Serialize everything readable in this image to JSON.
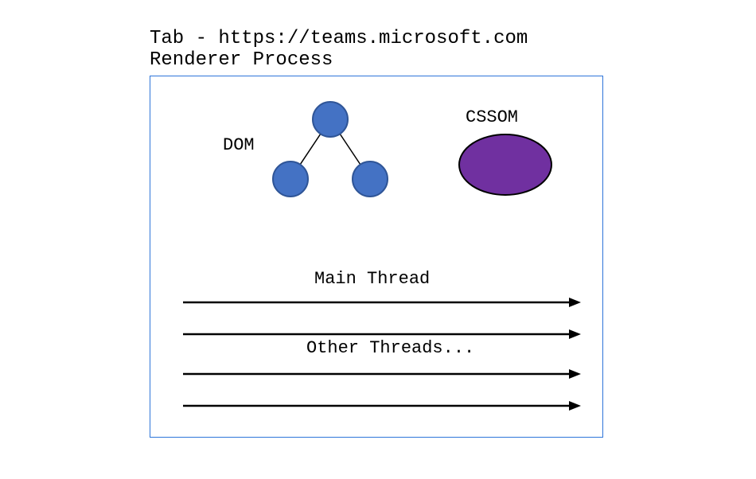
{
  "header": {
    "tab_line": "Tab - https://teams.microsoft.com",
    "renderer_line": "Renderer Process"
  },
  "labels": {
    "dom": "DOM",
    "cssom": "CSSOM",
    "main_thread": "Main Thread",
    "other_threads": "Other Threads..."
  },
  "colors": {
    "box_border": "#2e75d9",
    "dom_circle_fill": "#4472c4",
    "dom_circle_stroke": "#2f5597",
    "cssom_fill": "#7030a0",
    "cssom_stroke": "#000",
    "arrow": "#000"
  }
}
